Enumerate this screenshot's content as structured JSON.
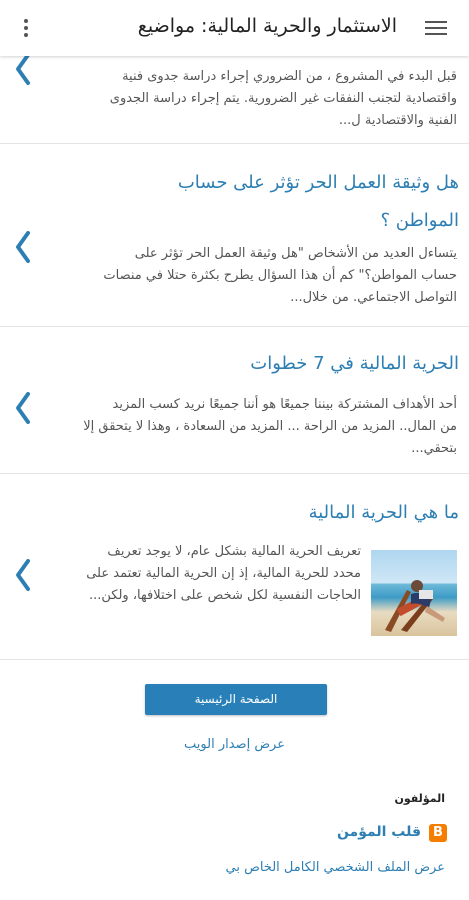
{
  "appbar": {
    "title": "الاستثمار والحرية المالية: مواضيع",
    "menu_icon": "hamburger-menu-icon",
    "overflow_icon": "more-vert-icon"
  },
  "posts": [
    {
      "title": "",
      "snippet": [
        "قبل البدء في المشروع ، من الضروري إجراء دراسة جدوى فنية",
        "واقتصادية لتجنب النفقات غير الضرورية. يتم إجراء دراسة الجدوى",
        "الفنية والاقتصادية ل..."
      ]
    },
    {
      "title_lines": [
        "هل وثيقة العمل الحر تؤثر على حساب",
        "المواطن ؟"
      ],
      "snippet": [
        "يتساءل العديد من الأشخاص \"هل وثيقة العمل الحر تؤثر على",
        "حساب المواطن؟\" كم أن هذا السؤال يطرح بكثرة حتلا في منصات",
        "التواصل الاجتماعي. من خلال..."
      ]
    },
    {
      "title": "الحرية المالية في 7 خطوات",
      "snippet": [
        "أحد الأهداف المشتركة بيننا جميعًا هو أننا جميعًا نريد كسب المزيد",
        "من المال.. المزيد من الراحة ... المزيد من السعادة ، وهذا لا يتحقق إلا",
        "بتحقي..."
      ]
    },
    {
      "title": "ما هي الحرية المالية",
      "snippet": [
        "تعريف الحرية المالية بشكل عام، لا يوجد تعريف",
        "محدد للحرية المالية، إذ إن الحرية المالية تعتمد على",
        "الحاجات النفسية لكل شخص على اختلافها، ولكن..."
      ]
    }
  ],
  "footer": {
    "home_button": "الصفحة الرئيسية",
    "web_version": "عرض إصدار الويب",
    "authors_label": "المؤلفون",
    "blogger_icon_letter": "B",
    "author_name": "قلب المؤمن",
    "profile_link": "عرض الملف الشخصي الكامل الخاص بي"
  },
  "colors": {
    "link": "#2d7fb3",
    "button": "#2980b9",
    "blogger": "#f57d00"
  }
}
